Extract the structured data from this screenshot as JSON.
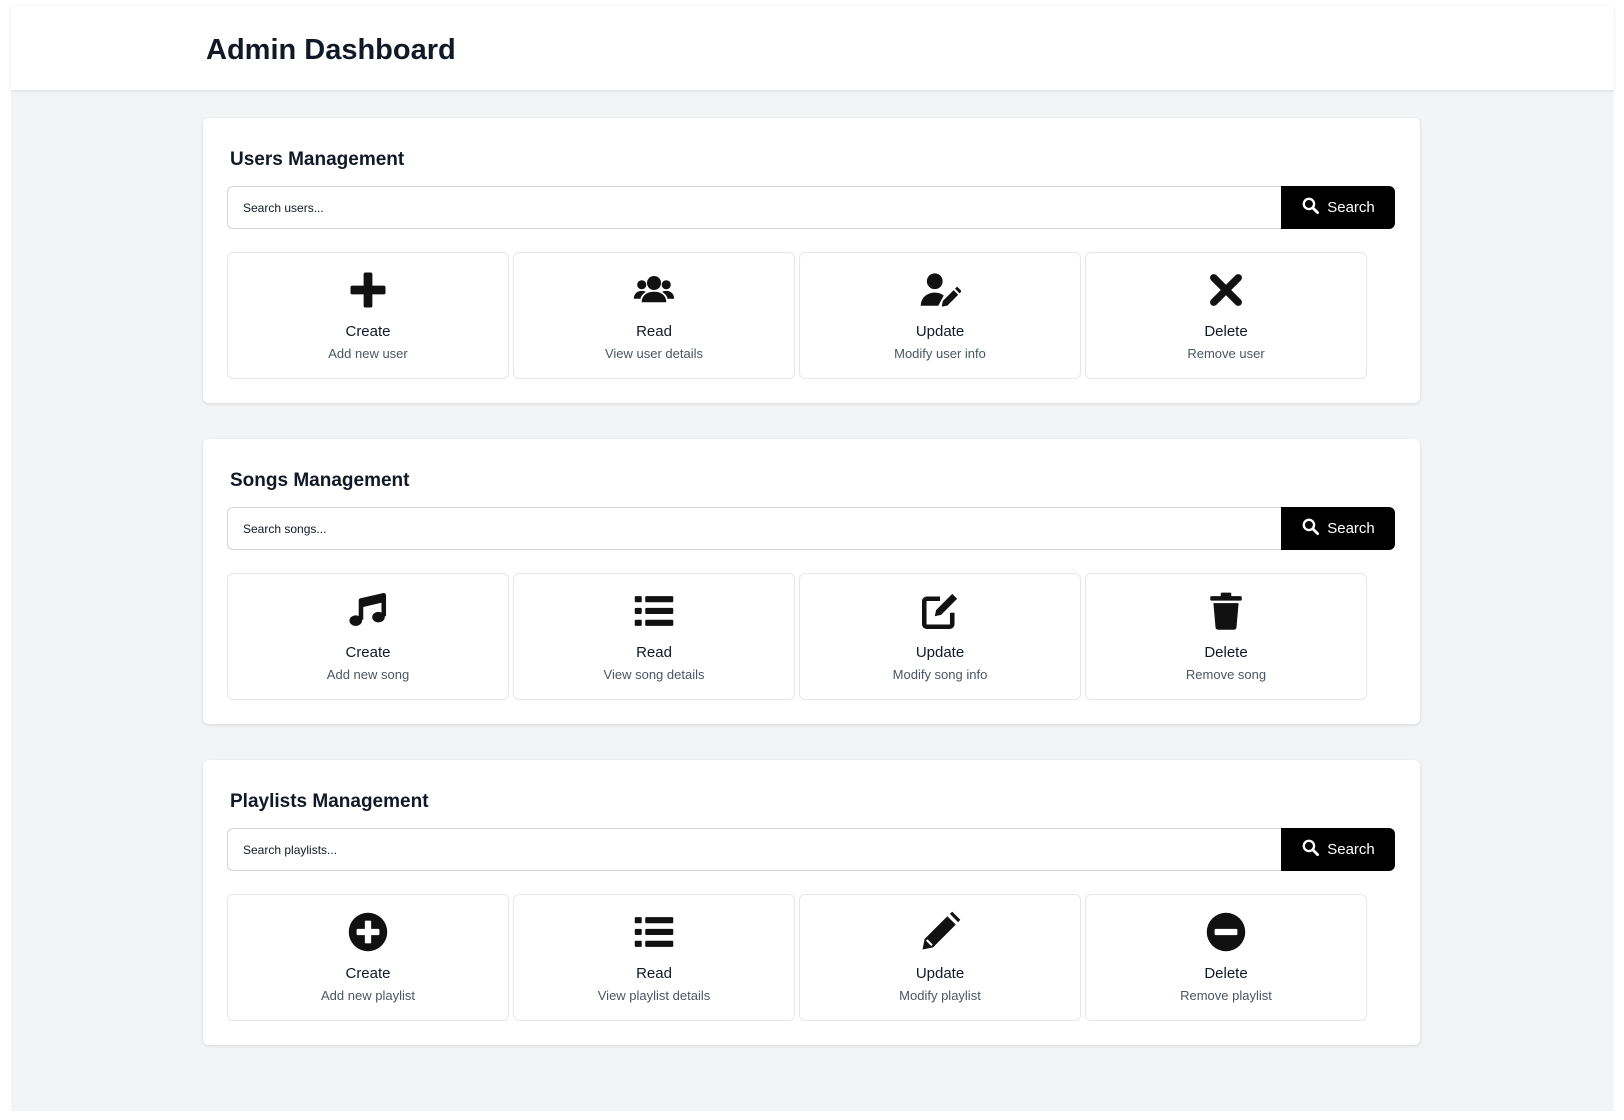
{
  "page": {
    "title": "Admin Dashboard"
  },
  "sections": [
    {
      "title": "Users Management",
      "search": {
        "placeholder": "Search users...",
        "button_label": "Search"
      },
      "cards": [
        {
          "label": "Create",
          "desc": "Add new user",
          "icon": "plus-icon"
        },
        {
          "label": "Read",
          "desc": "View user details",
          "icon": "users-icon"
        },
        {
          "label": "Update",
          "desc": "Modify user info",
          "icon": "user-edit-icon"
        },
        {
          "label": "Delete",
          "desc": "Remove user",
          "icon": "close-icon"
        }
      ]
    },
    {
      "title": "Songs Management",
      "search": {
        "placeholder": "Search songs...",
        "button_label": "Search"
      },
      "cards": [
        {
          "label": "Create",
          "desc": "Add new song",
          "icon": "music-icon"
        },
        {
          "label": "Read",
          "desc": "View song details",
          "icon": "list-icon"
        },
        {
          "label": "Update",
          "desc": "Modify song info",
          "icon": "edit-icon"
        },
        {
          "label": "Delete",
          "desc": "Remove song",
          "icon": "trash-icon"
        }
      ]
    },
    {
      "title": "Playlists Management",
      "search": {
        "placeholder": "Search playlists...",
        "button_label": "Search"
      },
      "cards": [
        {
          "label": "Create",
          "desc": "Add new playlist",
          "icon": "plus-circle-icon"
        },
        {
          "label": "Read",
          "desc": "View playlist details",
          "icon": "list-icon"
        },
        {
          "label": "Update",
          "desc": "Modify playlist",
          "icon": "pencil-icon"
        },
        {
          "label": "Delete",
          "desc": "Remove playlist",
          "icon": "minus-circle-icon"
        }
      ]
    }
  ],
  "colors": {
    "background": "#f3f4f6",
    "surface": "#ffffff",
    "button": "#000000",
    "text": "#111827",
    "muted_text": "#4b5563"
  }
}
